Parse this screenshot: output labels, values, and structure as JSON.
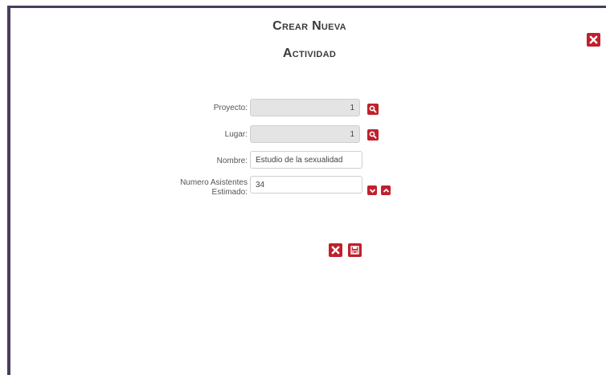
{
  "dialog": {
    "title_line1": "Crear Nueva",
    "title_line2": "Actividad"
  },
  "form": {
    "proyecto": {
      "label": "Proyecto:",
      "value": "1"
    },
    "lugar": {
      "label": "Lugar:",
      "value": "1"
    },
    "nombre": {
      "label": "Nombre:",
      "value": "Estudio de la sexualidad"
    },
    "asistentes": {
      "label_line1": "Numero Asistentes",
      "label_line2": "Estimado:",
      "value": "34"
    }
  },
  "icons": {
    "close": "close-icon",
    "search": "search-icon",
    "decrement": "chevron-down-icon",
    "increment": "chevron-up-icon",
    "save": "save-icon"
  },
  "colors": {
    "accent": "#c0202c",
    "border": "#4a3d5c"
  }
}
